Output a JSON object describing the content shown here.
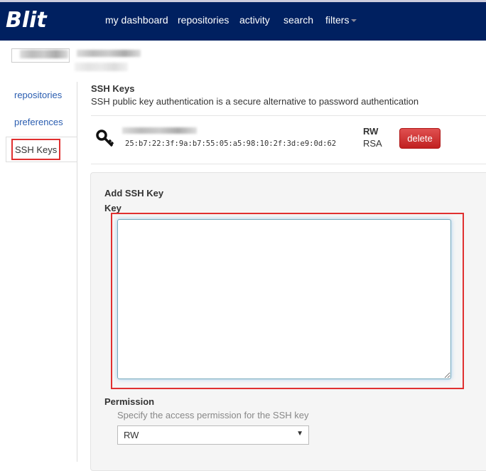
{
  "nav": {
    "logo": "Blit",
    "items": [
      "my dashboard",
      "repositories",
      "activity",
      "search",
      "filters"
    ]
  },
  "sidebar": {
    "items": [
      "repositories",
      "preferences",
      "SSH Keys"
    ],
    "active": "SSH Keys"
  },
  "main": {
    "title": "SSH Keys",
    "subtitle": "SSH public key authentication is a secure alternative to password authentication",
    "key": {
      "fingerprint": "25:b7:22:3f:9a:b7:55:05:a5:98:10:2f:3d:e9:0d:62",
      "permission": "RW",
      "type": "RSA",
      "delete_label": "delete"
    },
    "add": {
      "title": "Add SSH Key",
      "key_label": "Key",
      "key_value": "",
      "permission_label": "Permission",
      "permission_help": "Specify the access permission for the SSH key",
      "permission_value": "RW"
    }
  },
  "colors": {
    "navbar": "#002060",
    "delete": "#d03030",
    "highlight": "#e03030"
  }
}
